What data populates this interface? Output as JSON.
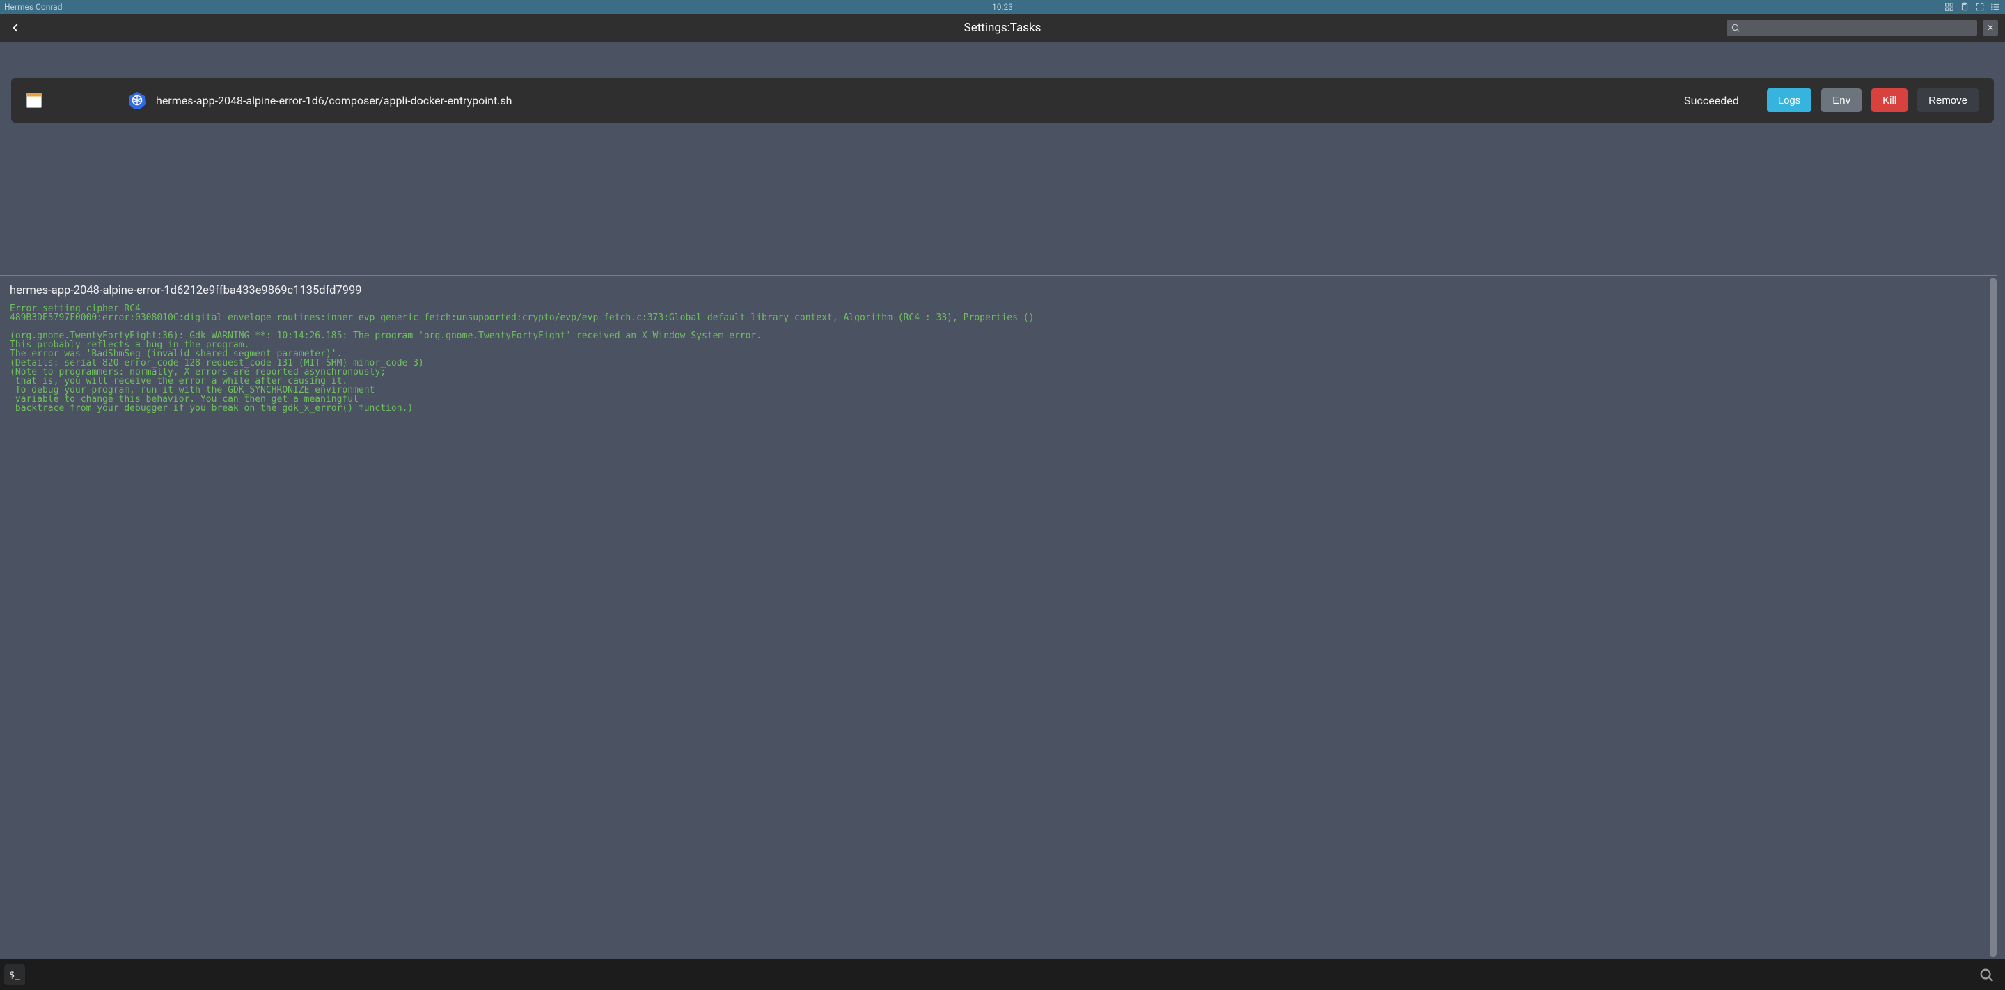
{
  "sysbar": {
    "user": "Hermes Conrad",
    "clock": "10:23"
  },
  "appbar": {
    "title": "Settings:Tasks",
    "search_value": "",
    "search_placeholder": ""
  },
  "task": {
    "name": "hermes-app-2048-alpine-error-1d6/composer/appli-docker-entrypoint.sh",
    "status": "Succeeded",
    "buttons": {
      "logs": "Logs",
      "env": "Env",
      "kill": "Kill",
      "remove": "Remove"
    }
  },
  "log": {
    "title": "hermes-app-2048-alpine-error-1d6212e9ffba433e9869c1135dfd7999",
    "body": "Error setting cipher RC4\n489B3DE5797F0000:error:0308010C:digital envelope routines:inner_evp_generic_fetch:unsupported:crypto/evp/evp_fetch.c:373:Global default library context, Algorithm (RC4 : 33), Properties ()\n\n(org.gnome.TwentyFortyEight:36): Gdk-WARNING **: 10:14:26.185: The program 'org.gnome.TwentyFortyEight' received an X Window System error.\nThis probably reflects a bug in the program.\nThe error was 'BadShmSeg (invalid shared segment parameter)'.\n(Details: serial 820 error_code 128 request_code 131 (MIT-SHM) minor_code 3)\n(Note to programmers: normally, X errors are reported asynchronously;\n that is, you will receive the error a while after causing it.\n To debug your program, run it with the GDK_SYNCHRONIZE environment\n variable to change this behavior. You can then get a meaningful\n backtrace from your debugger if you break on the gdk_x_error() function.)"
  },
  "dock": {
    "terminal_glyph": "$_"
  }
}
